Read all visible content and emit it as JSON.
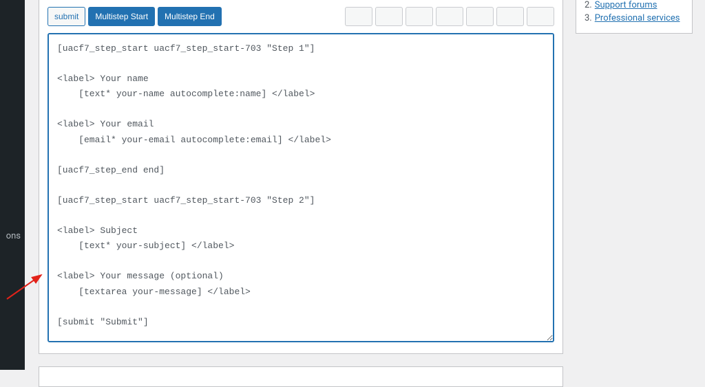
{
  "sidebar": {
    "visible_text": "ons"
  },
  "tagRow": {
    "submit": "submit",
    "multistepStart": "Multistep Start",
    "multistepEnd": "Multistep End"
  },
  "formCode": "[uacf7_step_start uacf7_step_start-703 \"Step 1\"]\n\n<label> Your name\n    [text* your-name autocomplete:name] </label>\n\n<label> Your email\n    [email* your-email autocomplete:email] </label>\n\n[uacf7_step_end end]\n\n[uacf7_step_start uacf7_step_start-703 \"Step 2\"]\n\n<label> Subject\n    [text* your-subject] </label>\n\n<label> Your message (optional)\n    [textarea your-message] </label>\n\n[submit \"Submit\"]\n",
  "sideLinks": {
    "item2_num": "2.",
    "item2_label": "Support forums",
    "item3_num": "3.",
    "item3_label": "Professional services"
  }
}
